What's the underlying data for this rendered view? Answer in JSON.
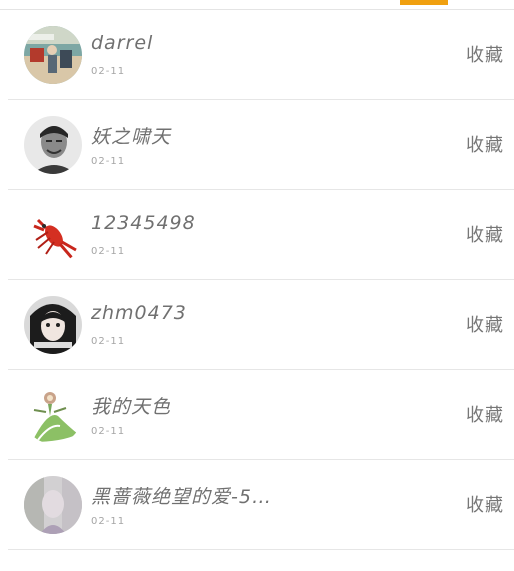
{
  "tabs": {
    "active_color": "#f0a010"
  },
  "list": {
    "items": [
      {
        "name": "darrel",
        "date": "02-11",
        "action": "收藏",
        "avatar": "avatar-photo-outdoor"
      },
      {
        "name": "妖之啸天",
        "date": "02-11",
        "action": "收藏",
        "avatar": "avatar-photo-man"
      },
      {
        "name": "12345498",
        "date": "02-11",
        "action": "收藏",
        "avatar": "avatar-lobster"
      },
      {
        "name": "zhm0473",
        "date": "02-11",
        "action": "收藏",
        "avatar": "avatar-photo-woman"
      },
      {
        "name": "我的天色",
        "date": "02-11",
        "action": "收藏",
        "avatar": "avatar-creature"
      },
      {
        "name": "黑蔷薇绝望的爱-5…",
        "date": "02-11",
        "action": "收藏",
        "avatar": "avatar-photo-blur"
      }
    ]
  }
}
